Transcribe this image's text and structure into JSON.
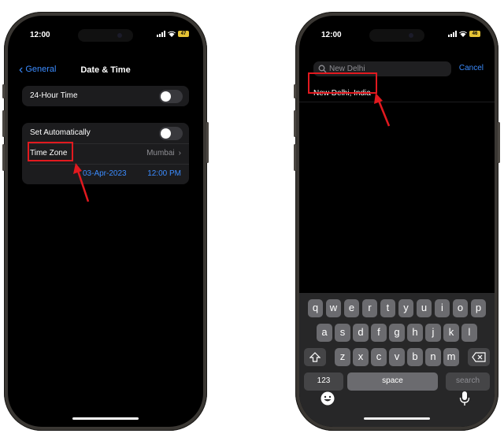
{
  "status": {
    "time": "12:00"
  },
  "left_phone": {
    "battery": "47",
    "nav": {
      "back_label": "General",
      "title": "Date & Time"
    },
    "settings": {
      "hour24_label": "24-Hour Time",
      "hour24_on": false,
      "set_auto_label": "Set Automatically",
      "set_auto_on": false,
      "timezone_label": "Time Zone",
      "timezone_value": "Mumbai",
      "date_value": "03-Apr-2023",
      "time_value": "12:00 PM"
    }
  },
  "right_phone": {
    "battery": "46",
    "search": {
      "query": "New Delhi",
      "cancel_label": "Cancel"
    },
    "results": [
      {
        "label": "New Delhi, India"
      }
    ],
    "keyboard": {
      "row1": [
        "q",
        "w",
        "e",
        "r",
        "t",
        "y",
        "u",
        "i",
        "o",
        "p"
      ],
      "row2": [
        "a",
        "s",
        "d",
        "f",
        "g",
        "h",
        "j",
        "k",
        "l"
      ],
      "row3": [
        "z",
        "x",
        "c",
        "v",
        "b",
        "n",
        "m"
      ],
      "numbers_label": "123",
      "space_label": "space",
      "search_label": "search"
    }
  },
  "annotation_color": "#e1191f"
}
